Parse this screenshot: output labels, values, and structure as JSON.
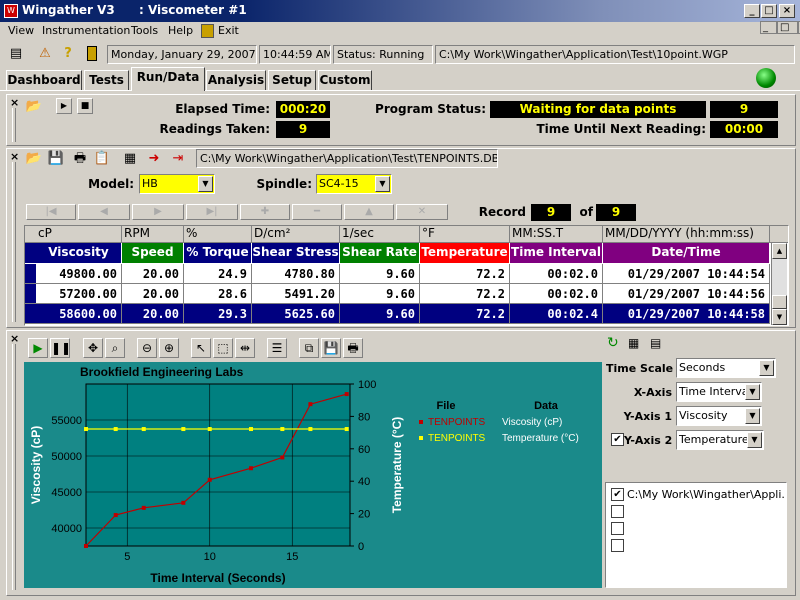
{
  "window": {
    "app_title": "Wingather V3",
    "doc_title": ": Viscometer #1",
    "minimize": "_",
    "restore": "□",
    "close": "×"
  },
  "menu": [
    "View",
    "Instrumentation",
    "Tools",
    "Help",
    "Exit"
  ],
  "status_bar": {
    "date": "Monday, January 29, 2007",
    "time": "10:44:59 AM",
    "status": "Status: Running",
    "path": "C:\\My Work\\Wingather\\Application\\Test\\10point.WGP"
  },
  "tabs": [
    "Dashboard",
    "Tests",
    "Run/Data",
    "Analysis",
    "Setup",
    "Custom"
  ],
  "active_tab": "Run/Data",
  "program": {
    "elapsed_label": "Elapsed Time:",
    "elapsed_value": "000:20",
    "readings_label": "Readings Taken:",
    "readings_value": "9",
    "status_label": "Program Status:",
    "status_value": "Waiting for data points",
    "status_count": "9",
    "next_label": "Time Until Next Reading:",
    "next_value": "00:00"
  },
  "data_file": {
    "path": "C:\\My Work\\Wingather\\Application\\Test\\TENPOINTS.DB",
    "model_label": "Model:",
    "model_value": "HB",
    "spindle_label": "Spindle:",
    "spindle_value": "SC4-15",
    "record_label": "Record",
    "record_current": "9",
    "record_of": "of",
    "record_total": "9"
  },
  "grid": {
    "units": [
      "cP",
      "RPM",
      "%",
      "D/cm²",
      "1/sec",
      "°F",
      "MM:SS.T",
      "MM/DD/YYYY (hh:mm:ss)"
    ],
    "headers": [
      "Viscosity",
      "Speed",
      "% Torque",
      "Shear Stress",
      "Shear Rate",
      "Temperature",
      "Time Interval",
      "Date/Time"
    ],
    "header_colors": [
      "#000080",
      "#008000",
      "#000080",
      "#000080",
      "#008000",
      "#ff0000",
      "#800080",
      "#800080"
    ],
    "rows": [
      [
        "49800.00",
        "20.00",
        "24.9",
        "4780.80",
        "9.60",
        "72.2",
        "00:02.0",
        "01/29/2007 10:44:54"
      ],
      [
        "57200.00",
        "20.00",
        "28.6",
        "5491.20",
        "9.60",
        "72.2",
        "00:02.0",
        "01/29/2007 10:44:56"
      ],
      [
        "58600.00",
        "20.00",
        "29.3",
        "5625.60",
        "9.60",
        "72.2",
        "00:02.4",
        "01/29/2007 10:44:58"
      ]
    ],
    "selected_row": 2
  },
  "chart_data": {
    "type": "line",
    "title": "Brookfield Engineering Labs",
    "xlabel": "Time Interval (Seconds)",
    "ylabel": "Viscosity (cP)",
    "y2label": "Temperature (°C)",
    "xlim": [
      2.5,
      18.5
    ],
    "ylim": [
      37500,
      60000
    ],
    "y2lim": [
      0,
      100
    ],
    "xticks": [
      5,
      10,
      15
    ],
    "yticks": [
      40000,
      45000,
      50000,
      55000
    ],
    "y2ticks": [
      0,
      20,
      40,
      60,
      80,
      100
    ],
    "grid": true,
    "legend_position": "right",
    "legend_headers": [
      "File",
      "Data"
    ],
    "series": [
      {
        "file": "TENPOINTS",
        "name": "Viscosity (cP)",
        "axis": "y",
        "color": "#c00000",
        "x": [
          2.5,
          4.3,
          6.0,
          8.4,
          10.0,
          12.5,
          14.4,
          16.1,
          18.3
        ],
        "y": [
          37500,
          41800,
          42800,
          43500,
          46700,
          48300,
          49800,
          57200,
          58600
        ]
      },
      {
        "file": "TENPOINTS",
        "name": "Temperature (°C)",
        "axis": "y2",
        "color": "#ffff00",
        "x": [
          2.5,
          4.3,
          6.0,
          8.4,
          10.0,
          12.5,
          14.4,
          16.1,
          18.3
        ],
        "y": [
          72.2,
          72.2,
          72.2,
          72.2,
          72.2,
          72.2,
          72.2,
          72.2,
          72.2
        ]
      }
    ]
  },
  "graph_settings": {
    "time_scale_label": "Time Scale",
    "time_scale_value": "Seconds",
    "x_axis_label": "X-Axis",
    "x_axis_value": "Time Interval",
    "y_axis1_label": "Y-Axis 1",
    "y_axis1_value": "Viscosity",
    "y_axis2_label": "Y-Axis 2",
    "y_axis2_value": "Temperature",
    "y_axis2_checked": true
  },
  "file_list": [
    {
      "checked": true,
      "label": "C:\\My Work\\Wingather\\Appli..."
    },
    {
      "checked": false,
      "label": ""
    },
    {
      "checked": false,
      "label": ""
    },
    {
      "checked": false,
      "label": ""
    }
  ],
  "colors": {
    "title_bar": "#0a246a",
    "chart_bg": "#1a8a8a",
    "plot_bg": "#008080",
    "selected_row": "#000080",
    "lcd_text": "#ffff00"
  }
}
